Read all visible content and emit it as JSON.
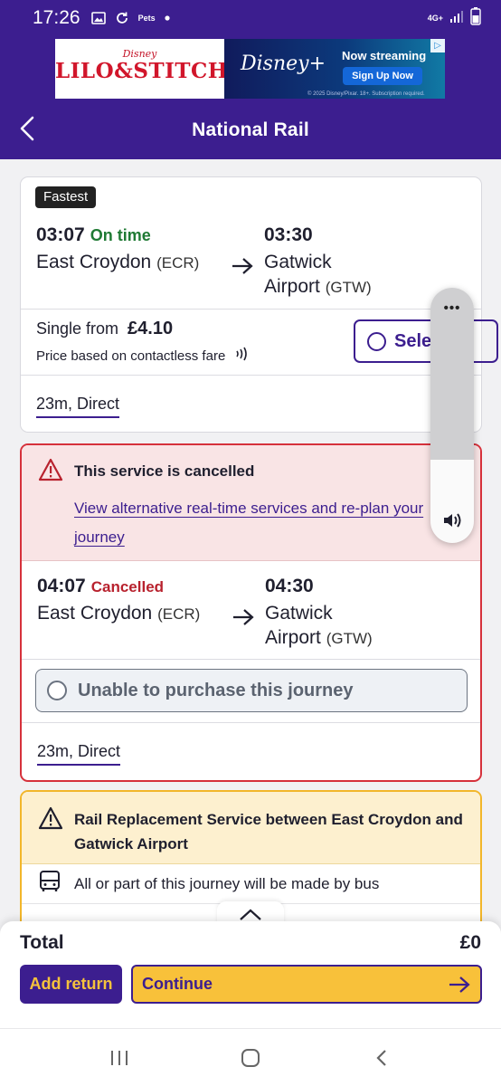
{
  "status_bar": {
    "time": "17:26",
    "carrier_tag": "Pets",
    "network": "4G+"
  },
  "ad": {
    "brand_small": "Disney",
    "brand_big": "LILO&STITCH",
    "service": "Disney+",
    "cta_text": "Now streaming",
    "cta_button": "Sign Up Now",
    "fine_print": "© 2025 Disney/Pixar. 18+. Subscription required."
  },
  "header": {
    "title": "National Rail"
  },
  "journeys": [
    {
      "badge": "Fastest",
      "dep_time": "03:07",
      "status": "On time",
      "from_station": "East Croydon",
      "from_code": "(ECR)",
      "arr_time": "03:30",
      "to_station_line1": "Gatwick",
      "to_station_line2": "Airport",
      "to_code": "(GTW)",
      "price_label": "Single from",
      "price": "£4.10",
      "price_note": "Price based on contactless fare",
      "select_label": "Select",
      "duration": "23m, Direct"
    },
    {
      "alert_title": "This service is cancelled",
      "alert_link": "View alternative real-time services and re-plan your journey",
      "dep_time": "04:07",
      "status": "Cancelled",
      "from_station": "East Croydon",
      "from_code": "(ECR)",
      "arr_time": "04:30",
      "to_station_line1": "Gatwick",
      "to_station_line2": "Airport",
      "to_code": "(GTW)",
      "unable_label": "Unable to purchase this journey",
      "duration": "23m, Direct"
    },
    {
      "alert_title": "Rail Replacement Service between East Croydon and Gatwick Airport",
      "bus_note": "All or part of this journey will be made by bus"
    }
  ],
  "footer": {
    "total_label": "Total",
    "total_value": "£0",
    "add_return_label": "Add return",
    "continue_label": "Continue"
  },
  "colors": {
    "brand_purple": "#3c1e8f",
    "accent_yellow": "#f8c13a",
    "ok_green": "#1f7a34",
    "alert_red": "#d6313b"
  }
}
